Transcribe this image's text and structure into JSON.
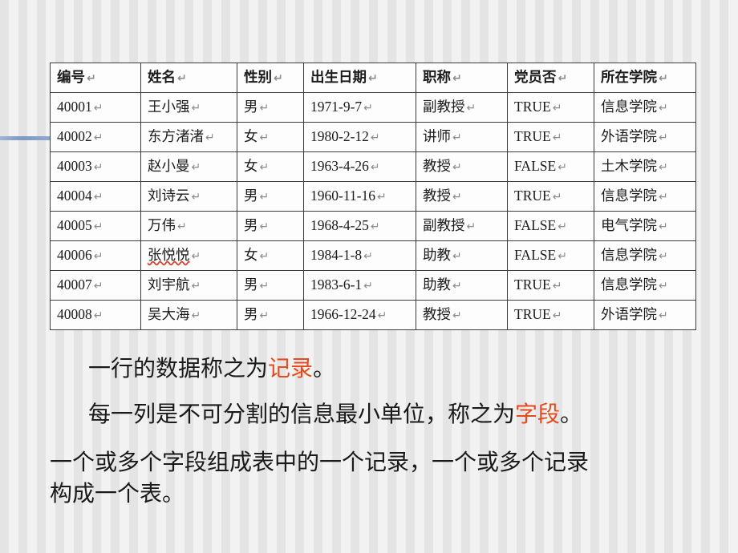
{
  "slide": {
    "accent_color": "#8fa8cd",
    "highlight_color": "#e8491d",
    "table_border_color": "#3b3b3b"
  },
  "table": {
    "headers": [
      "编号",
      "姓名",
      "性别",
      "出生日期",
      "职称",
      "党员否",
      "所在学院"
    ],
    "paragraph_mark": "↵",
    "rows": [
      {
        "id": "40001",
        "name": "王小强",
        "gender": "男",
        "birth_date": "1971-9-7",
        "title": "副教授",
        "party_member": "TRUE",
        "college": "信息学院",
        "name_misspelled": false
      },
      {
        "id": "40002",
        "name": "东方渚渚",
        "gender": "女",
        "birth_date": "1980-2-12",
        "title": "讲师",
        "party_member": "TRUE",
        "college": "外语学院",
        "name_misspelled": false
      },
      {
        "id": "40003",
        "name": "赵小曼",
        "gender": "女",
        "birth_date": "1963-4-26",
        "title": "教授",
        "party_member": "FALSE",
        "college": "土木学院",
        "name_misspelled": false
      },
      {
        "id": "40004",
        "name": "刘诗云",
        "gender": "男",
        "birth_date": "1960-11-16",
        "title": "教授",
        "party_member": "TRUE",
        "college": "信息学院",
        "name_misspelled": false
      },
      {
        "id": "40005",
        "name": "万伟",
        "gender": "男",
        "birth_date": "1968-4-25",
        "title": "副教授",
        "party_member": "FALSE",
        "college": "电气学院",
        "name_misspelled": false
      },
      {
        "id": "40006",
        "name": "张悦悦",
        "gender": "女",
        "birth_date": "1984-1-8",
        "title": "助教",
        "party_member": "FALSE",
        "college": "信息学院",
        "name_misspelled": true
      },
      {
        "id": "40007",
        "name": "刘宇航",
        "gender": "男",
        "birth_date": "1983-6-1",
        "title": "助教",
        "party_member": "TRUE",
        "college": "信息学院",
        "name_misspelled": false
      },
      {
        "id": "40008",
        "name": "吴大海",
        "gender": "男",
        "birth_date": "1966-12-24",
        "title": "教授",
        "party_member": "TRUE",
        "college": "外语学院",
        "name_misspelled": false
      }
    ]
  },
  "body": {
    "p1_before": "一行的数据称之为",
    "p1_highlight": "记录",
    "p1_after": "。",
    "p2_before": "每一列是不可分割的信息最小单位，称之为",
    "p2_highlight": "字段",
    "p2_after": "。",
    "p3_line1": "一个或多个字段组成表中的一个记录，一个或多个记录",
    "p3_line2": "构成一个表。"
  }
}
